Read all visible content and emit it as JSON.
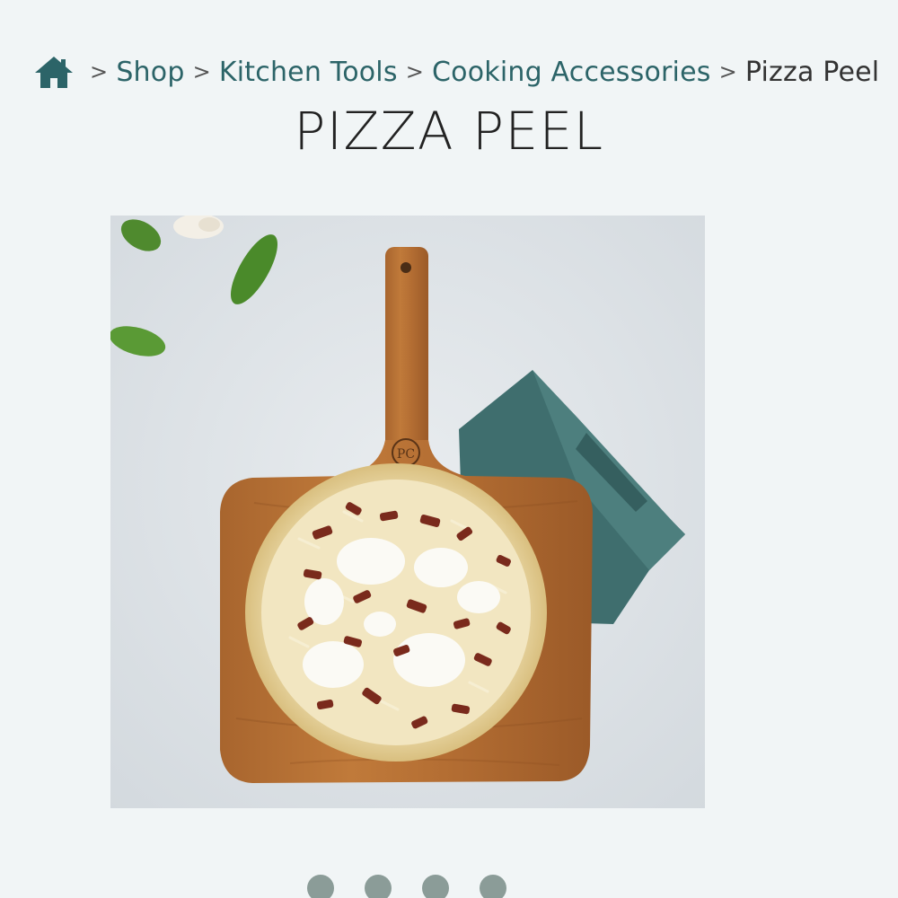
{
  "breadcrumb": {
    "home_icon": "home-icon",
    "separator": ">",
    "items": [
      {
        "label": "Shop"
      },
      {
        "label": "Kitchen Tools"
      },
      {
        "label": "Cooking Accessories"
      }
    ],
    "current": "Pizza Peel"
  },
  "title": "PIZZA PEEL",
  "image": {
    "subject": "wooden pizza peel with pizza, basil leaves, garlic and teal napkin"
  },
  "carousel": {
    "dot_count": 4
  },
  "colors": {
    "link": "#2c6468",
    "background": "#f1f5f6",
    "dot": "#8b9c98"
  }
}
